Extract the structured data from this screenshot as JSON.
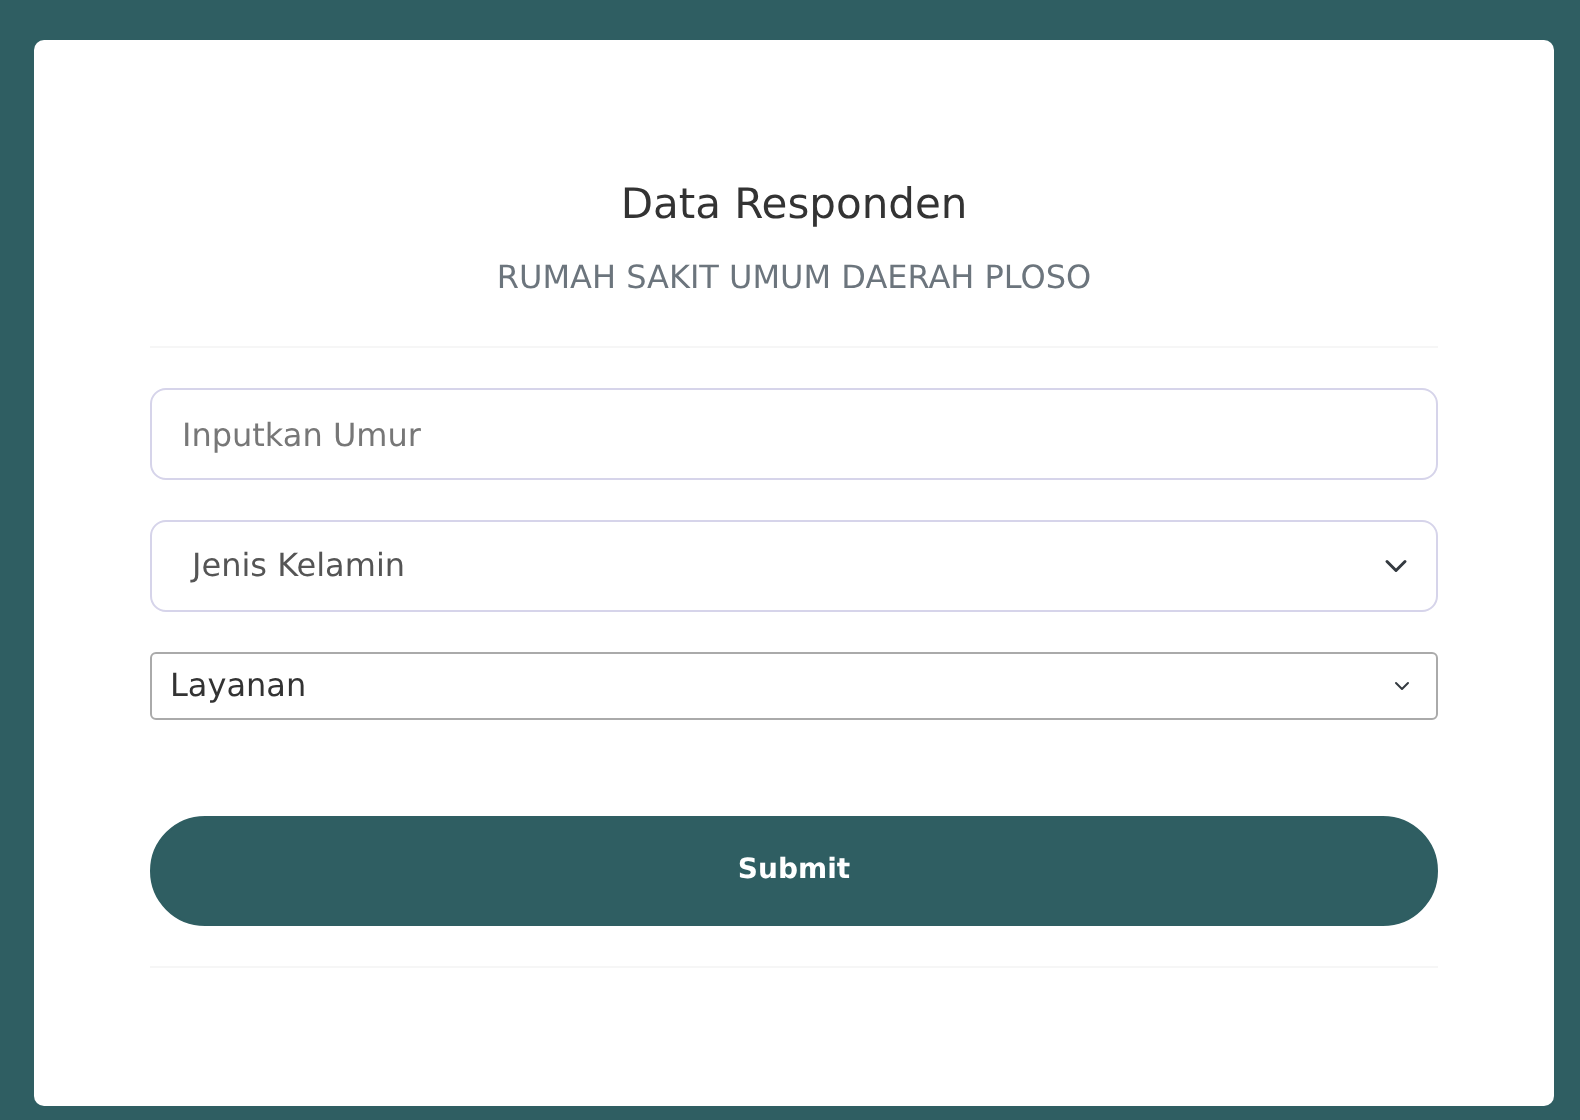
{
  "title": "Data Responden",
  "subtitle": "RUMAH SAKIT UMUM DAERAH PLOSO",
  "fields": [
    {
      "kind": "input",
      "placeholder": "Inputkan Umur"
    },
    {
      "kind": "select",
      "value": "Jenis Kelamin"
    },
    {
      "kind": "select2",
      "value": "Layanan"
    }
  ],
  "submit": "Submit"
}
